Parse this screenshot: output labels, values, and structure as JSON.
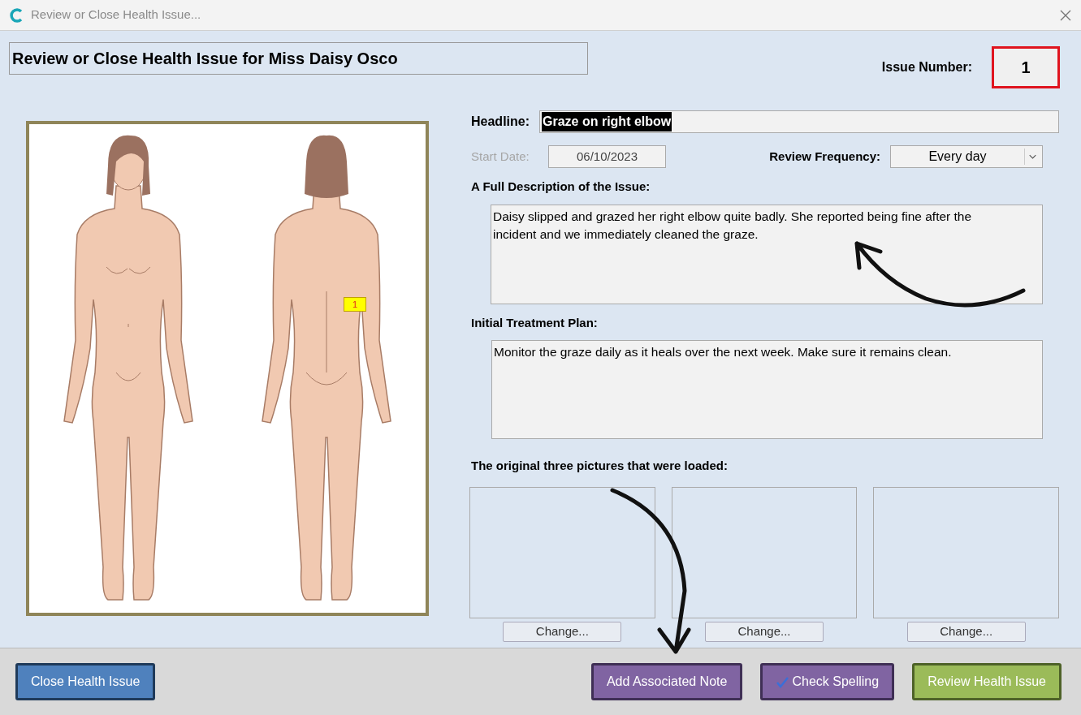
{
  "window": {
    "title": "Review or Close Health Issue..."
  },
  "heading": "Review or Close Health Issue for Miss Daisy Osco",
  "issue_number": {
    "label": "Issue Number:",
    "value": "1",
    "highlighted": true
  },
  "body_map": {
    "markers": [
      {
        "label": "1"
      }
    ]
  },
  "headline": {
    "label": "Headline:",
    "value": "Graze on right elbow",
    "text_selected": true
  },
  "start_date": {
    "label": "Start Date:",
    "value": "06/10/2023",
    "disabled": true
  },
  "review_frequency": {
    "label": "Review Frequency:",
    "value": "Every day"
  },
  "description": {
    "label": "A Full Description of the Issue:",
    "value": "Daisy slipped and grazed her right elbow quite badly. She reported being fine after the incident and we immediately cleaned the graze."
  },
  "treatment_plan": {
    "label": "Initial Treatment Plan:",
    "value": "Monitor the graze daily as it heals over the next week. Make sure it remains clean."
  },
  "pictures": {
    "label": "The original three pictures that were loaded:",
    "slots": [
      {
        "button": "Change..."
      },
      {
        "button": "Change..."
      },
      {
        "button": "Change..."
      }
    ]
  },
  "buttons": [
    {
      "label": "Close Health Issue",
      "kind": "close"
    },
    {
      "label": "Add Associated Note",
      "kind": "note"
    },
    {
      "label": "Check Spelling",
      "kind": "spelling"
    },
    {
      "label": "Review Health Issue",
      "kind": "review"
    }
  ]
}
